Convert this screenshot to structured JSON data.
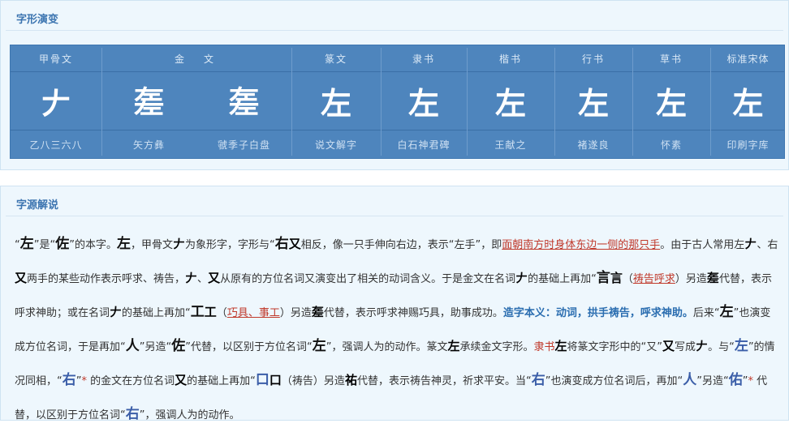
{
  "evolution": {
    "title": "字形演变",
    "columns": [
      {
        "header": "甲骨文",
        "glyphs": [
          {
            "char": "𠂇",
            "source": "乙八三六八"
          }
        ]
      },
      {
        "header": "金　文",
        "glyphs": [
          {
            "char": "𢀡",
            "source": "矢方彝"
          },
          {
            "char": "𢀡",
            "source": "虢季子白盘"
          }
        ]
      },
      {
        "header": "篆文",
        "glyphs": [
          {
            "char": "左",
            "source": "说文解字"
          }
        ]
      },
      {
        "header": "隶书",
        "glyphs": [
          {
            "char": "左",
            "source": "白石神君碑"
          }
        ]
      },
      {
        "header": "楷书",
        "glyphs": [
          {
            "char": "左",
            "source": "王献之"
          }
        ]
      },
      {
        "header": "行书",
        "glyphs": [
          {
            "char": "左",
            "source": "褚遂良"
          }
        ]
      },
      {
        "header": "草书",
        "glyphs": [
          {
            "char": "左",
            "source": "怀素"
          }
        ]
      },
      {
        "header": "标准宋体",
        "glyphs": [
          {
            "char": "左",
            "source": "印刷字库"
          }
        ]
      }
    ]
  },
  "explanation": {
    "title": "字源解说",
    "p1": {
      "a": "“",
      "zuo": "左",
      "b": "”是“",
      "zuo2": "佐",
      "c": "”的本字。",
      "zuo3": "左",
      "d": "，甲骨文",
      "g1": "𠂇",
      "e": "为象形字，字形与“",
      "you": "右",
      "g2": "又",
      "f": "相反，像一只手伸向右边，表示“左手”，即",
      "red1": "面朝南方时身体东边一侧的那只手",
      "g": "。由于古人常用左",
      "g3": "𠂇",
      "h": "、右",
      "g4": "又",
      "i": "两手的某些动作表示呼求、祷告，",
      "g5": "𠂇",
      "j": "、",
      "g6": "又",
      "k": "从原有的方位名词又演变出了相关的动词含义。于是金文在名词",
      "g7": "𠂇",
      "l": "的基础上再加“",
      "yan": "言",
      "g8": "言",
      "m": "（",
      "red2": "祷告呼求",
      "n": "）另造",
      "g9": "𢀡",
      "o": "代替，表示呼求神助；或在名词",
      "g10": "𠂇",
      "p": "的基础上再加“",
      "gong": "工",
      "g11": "工",
      "q": "（",
      "red3": "巧具、事工",
      "r": "）另造",
      "g12": "𢀡",
      "s": "代替，表示呼求神赐巧具，助事成功。",
      "blue": "造字本义：动词，拱手祷告，呼求神助。",
      "t": "后来“",
      "zuo4": "左",
      "u": "”也演变成方位名词，于是再加“",
      "ren": "人",
      "v": "”另造“",
      "zuo5": "佐",
      "w": "”代替，以区别于方位名词“",
      "zuo6": "左",
      "x": "”，强调人为的动作。篆文",
      "g13": "左",
      "y": "承续金文字形。",
      "z": "隶书",
      "g14": "左",
      "aa": "将篆文字形中的“又”",
      "g15": "又",
      "ab": "写成",
      "g16": "𠂇",
      "ac": "。与“",
      "zuo7": "左",
      "ad": "”的情况同相，“",
      "you2": "右",
      "ae": "”",
      "star1": "*",
      "af": " 的金文在方位名词",
      "g17": "又",
      "ag": "的基础上再加“",
      "kou": "口",
      "g18": "口",
      "ah": "（祷告）另造",
      "g19": "祐",
      "ai": "代替，表示祷告神灵，",
      "aj": "祈求平安。当“",
      "you3": "右",
      "ak": "”也演变成方位名词后，再加“",
      "ren2": "人",
      "al": "”另造“",
      "you4": "佑",
      "am": "”",
      "star2": "*",
      "an": " 代替，以区别于方位名词“",
      "you5": "右",
      "ao": "”，强调人为的动作。"
    }
  }
}
